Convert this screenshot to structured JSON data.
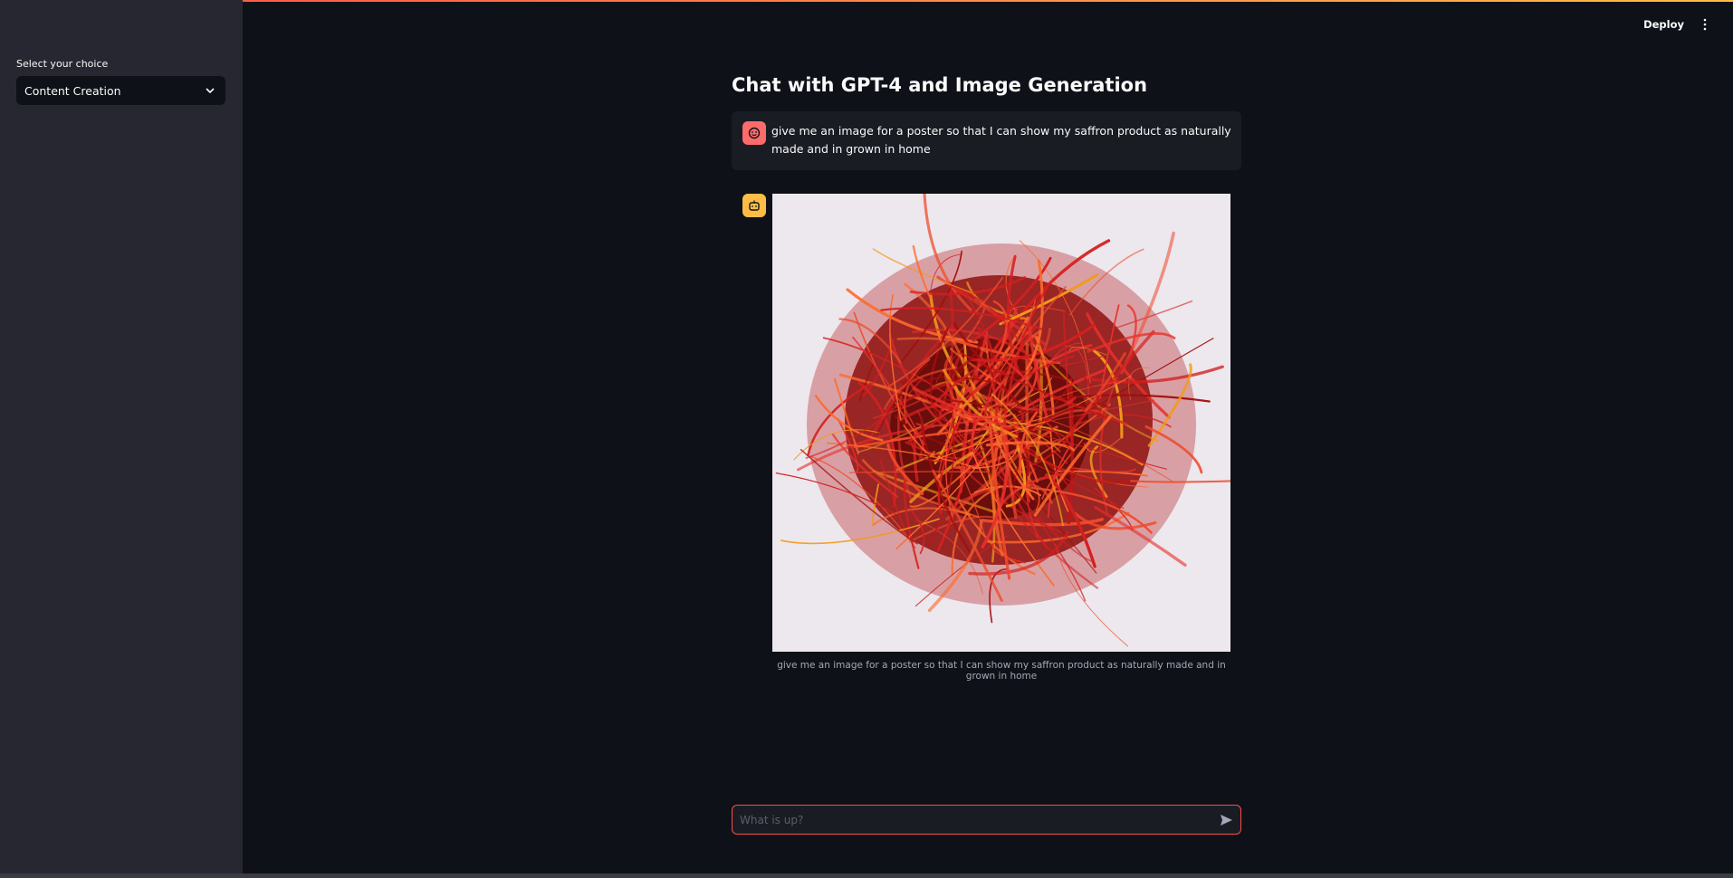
{
  "header": {
    "deploy_label": "Deploy"
  },
  "sidebar": {
    "label": "Select your choice",
    "select_value": "Content Creation"
  },
  "main": {
    "title": "Chat with GPT-4 and Image Generation",
    "messages": [
      {
        "role": "user",
        "text": "give me an image for a poster so that I can show my saffron product as naturally made and in grown in home"
      },
      {
        "role": "assistant",
        "caption": "give me an image for a poster so that I can show my saffron product as naturally made and in grown in home"
      }
    ],
    "chat_input": {
      "placeholder": "What is up?"
    }
  },
  "colors": {
    "accent": "#ff4b4b",
    "user_avatar": "#ff6b6b",
    "bot_avatar": "#ffbd45",
    "sidebar_bg": "#262730",
    "main_bg": "#0e1117"
  },
  "icons": {
    "select": "chevron-down-icon",
    "menu": "more-vertical-icon",
    "user": "user-face-icon",
    "assistant": "robot-icon",
    "send": "send-icon"
  }
}
